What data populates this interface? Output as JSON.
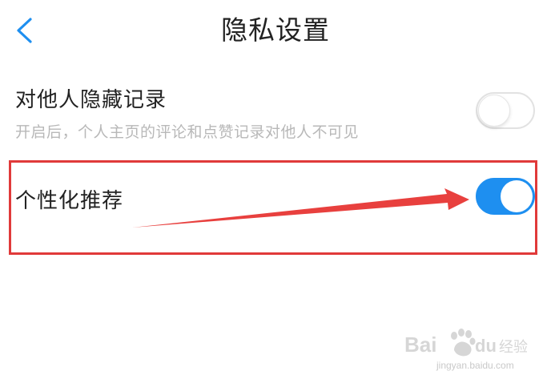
{
  "header": {
    "title": "隐私设置",
    "back_icon": "chevron-left-icon"
  },
  "settings": {
    "hide_records": {
      "title": "对他人隐藏记录",
      "description": "开启后，个人主页的评论和点赞记录对他人不可见",
      "enabled": false
    },
    "personalized": {
      "title": "个性化推荐",
      "enabled": true
    }
  },
  "colors": {
    "accent": "#1e8ff0",
    "annotation": "#e03a3a",
    "title_text": "#222222",
    "description_text": "#b8b8b8"
  },
  "watermark": {
    "logo": "Baidu经验",
    "url": "jingyan.baidu.com"
  }
}
